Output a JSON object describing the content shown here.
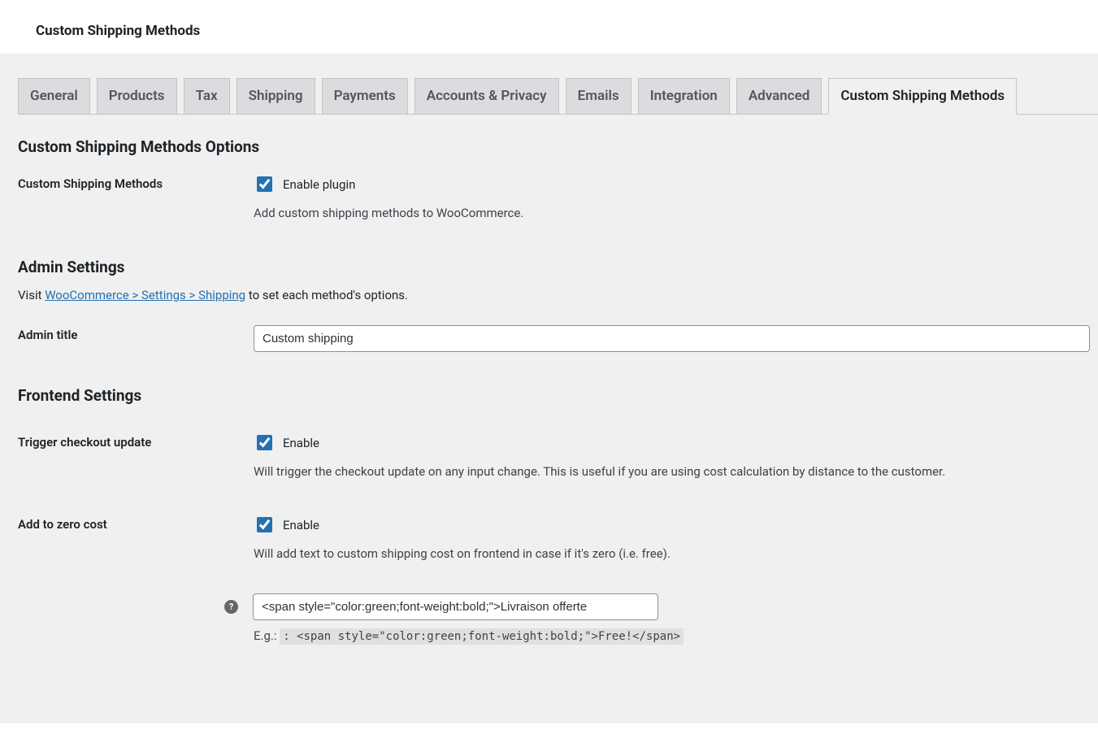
{
  "header": {
    "title": "Custom Shipping Methods"
  },
  "tabs": [
    {
      "label": "General"
    },
    {
      "label": "Products"
    },
    {
      "label": "Tax"
    },
    {
      "label": "Shipping"
    },
    {
      "label": "Payments"
    },
    {
      "label": "Accounts & Privacy"
    },
    {
      "label": "Emails"
    },
    {
      "label": "Integration"
    },
    {
      "label": "Advanced"
    },
    {
      "label": "Custom Shipping Methods",
      "active": true
    }
  ],
  "sections": {
    "options_title": "Custom Shipping Methods Options",
    "admin_title": "Admin Settings",
    "frontend_title": "Frontend Settings"
  },
  "fields": {
    "enable_plugin": {
      "label": "Custom Shipping Methods",
      "checkbox_label": "Enable plugin",
      "description": "Add custom shipping methods to WooCommerce."
    },
    "admin_visit_prefix": "Visit ",
    "admin_visit_link": "WooCommerce > Settings > Shipping",
    "admin_visit_suffix": " to set each method's options.",
    "admin_title": {
      "label": "Admin title",
      "value": "Custom shipping"
    },
    "trigger_checkout": {
      "label": "Trigger checkout update",
      "checkbox_label": "Enable",
      "description": "Will trigger the checkout update on any input change. This is useful if you are using cost calculation by distance to the customer."
    },
    "add_zero": {
      "label": "Add to zero cost",
      "checkbox_label": "Enable",
      "description": "Will add text to custom shipping cost on frontend in case if it's zero (i.e. free).",
      "text_value": "<span style=\"color:green;font-weight:bold;\">Livraison offerte",
      "example_prefix": "E.g.: ",
      "example_code": ": <span style=\"color:green;font-weight:bold;\">Free!</span>"
    }
  }
}
